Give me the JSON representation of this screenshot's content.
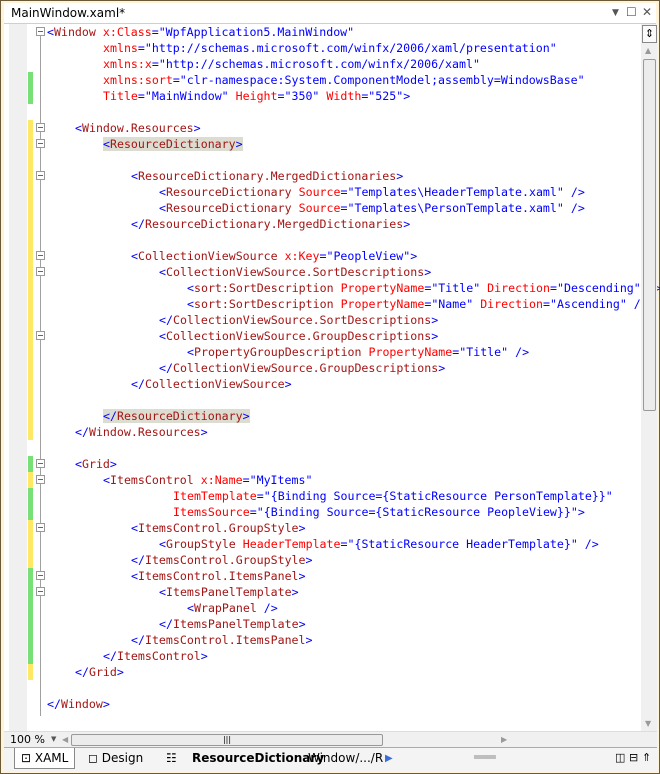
{
  "window": {
    "title": "MainWindow.xaml*"
  },
  "status": {
    "zoom": "100 %"
  },
  "bottom_tabs": [
    {
      "label": "XAML",
      "active": true
    },
    {
      "label": "Design",
      "active": false
    }
  ],
  "breadcrumb": {
    "current": "ResourceDictionary",
    "path": "Window/.../R"
  },
  "colors": {
    "tag": "#a31515",
    "attr": "#ff0000",
    "punct": "#0000ff",
    "changed_saved": "#77e177",
    "changed_unsaved": "#ffe866"
  },
  "code_lines": [
    {
      "indent": 0,
      "fold": true,
      "tokens": [
        [
          "p",
          "<"
        ],
        [
          "n",
          "Window"
        ],
        [
          "a",
          " x:Class"
        ],
        [
          "p",
          "="
        ],
        [
          "v",
          "\"WpfApplication5.MainWindow\""
        ]
      ]
    },
    {
      "indent": 8,
      "tokens": [
        [
          "a",
          "xmlns"
        ],
        [
          "p",
          "="
        ],
        [
          "v",
          "\"http://schemas.microsoft.com/winfx/2006/xaml/presentation\""
        ]
      ]
    },
    {
      "indent": 8,
      "tokens": [
        [
          "a",
          "xmlns:x"
        ],
        [
          "p",
          "="
        ],
        [
          "v",
          "\"http://schemas.microsoft.com/winfx/2006/xaml\""
        ]
      ]
    },
    {
      "indent": 8,
      "change": "green",
      "tokens": [
        [
          "a",
          "xmlns:sort"
        ],
        [
          "p",
          "="
        ],
        [
          "v",
          "\"clr-namespace:System.ComponentModel;assembly=WindowsBase\""
        ]
      ]
    },
    {
      "indent": 8,
      "change": "green",
      "tokens": [
        [
          "a",
          "Title"
        ],
        [
          "p",
          "="
        ],
        [
          "v",
          "\"MainWindow\""
        ],
        [
          "a",
          " Height"
        ],
        [
          "p",
          "="
        ],
        [
          "v",
          "\"350\""
        ],
        [
          "a",
          " Width"
        ],
        [
          "p",
          "="
        ],
        [
          "v",
          "\"525\""
        ],
        [
          "p",
          ">"
        ]
      ]
    },
    {
      "indent": 0,
      "tokens": []
    },
    {
      "indent": 4,
      "fold": true,
      "change": "yellow",
      "tokens": [
        [
          "p",
          "<"
        ],
        [
          "n",
          "Window.Resources"
        ],
        [
          "p",
          ">"
        ]
      ]
    },
    {
      "indent": 8,
      "fold": true,
      "change": "yellow",
      "highlight": true,
      "tokens": [
        [
          "p",
          "<"
        ],
        [
          "n",
          "ResourceDictionary"
        ],
        [
          "p",
          ">"
        ]
      ]
    },
    {
      "indent": 0,
      "change": "yellow",
      "tokens": []
    },
    {
      "indent": 12,
      "fold": true,
      "change": "yellow",
      "tokens": [
        [
          "p",
          "<"
        ],
        [
          "n",
          "ResourceDictionary.MergedDictionaries"
        ],
        [
          "p",
          ">"
        ]
      ]
    },
    {
      "indent": 16,
      "change": "yellow",
      "tokens": [
        [
          "p",
          "<"
        ],
        [
          "n",
          "ResourceDictionary"
        ],
        [
          "a",
          " Source"
        ],
        [
          "p",
          "="
        ],
        [
          "v",
          "\"Templates\\HeaderTemplate.xaml\""
        ],
        [
          "p",
          " />"
        ]
      ]
    },
    {
      "indent": 16,
      "change": "yellow",
      "tokens": [
        [
          "p",
          "<"
        ],
        [
          "n",
          "ResourceDictionary"
        ],
        [
          "a",
          " Source"
        ],
        [
          "p",
          "="
        ],
        [
          "v",
          "\"Templates\\PersonTemplate.xaml\""
        ],
        [
          "p",
          " />"
        ]
      ]
    },
    {
      "indent": 12,
      "change": "yellow",
      "tokens": [
        [
          "p",
          "</"
        ],
        [
          "n",
          "ResourceDictionary.MergedDictionaries"
        ],
        [
          "p",
          ">"
        ]
      ]
    },
    {
      "indent": 0,
      "change": "yellow",
      "tokens": []
    },
    {
      "indent": 12,
      "fold": true,
      "change": "yellow",
      "tokens": [
        [
          "p",
          "<"
        ],
        [
          "n",
          "CollectionViewSource"
        ],
        [
          "a",
          " x:Key"
        ],
        [
          "p",
          "="
        ],
        [
          "v",
          "\"PeopleView\""
        ],
        [
          "p",
          ">"
        ]
      ]
    },
    {
      "indent": 16,
      "fold": true,
      "change": "yellow",
      "tokens": [
        [
          "p",
          "<"
        ],
        [
          "n",
          "CollectionViewSource.SortDescriptions"
        ],
        [
          "p",
          ">"
        ]
      ]
    },
    {
      "indent": 20,
      "change": "yellow",
      "tokens": [
        [
          "p",
          "<"
        ],
        [
          "n",
          "sort:SortDescription"
        ],
        [
          "a",
          " PropertyName"
        ],
        [
          "p",
          "="
        ],
        [
          "v",
          "\"Title\""
        ],
        [
          "a",
          " Direction"
        ],
        [
          "p",
          "="
        ],
        [
          "v",
          "\"Descending\""
        ],
        [
          "p",
          " />"
        ]
      ]
    },
    {
      "indent": 20,
      "change": "yellow",
      "tokens": [
        [
          "p",
          "<"
        ],
        [
          "n",
          "sort:SortDescription"
        ],
        [
          "a",
          " PropertyName"
        ],
        [
          "p",
          "="
        ],
        [
          "v",
          "\"Name\""
        ],
        [
          "a",
          " Direction"
        ],
        [
          "p",
          "="
        ],
        [
          "v",
          "\"Ascending\""
        ],
        [
          "p",
          " />"
        ]
      ]
    },
    {
      "indent": 16,
      "change": "yellow",
      "tokens": [
        [
          "p",
          "</"
        ],
        [
          "n",
          "CollectionViewSource.SortDescriptions"
        ],
        [
          "p",
          ">"
        ]
      ]
    },
    {
      "indent": 16,
      "fold": true,
      "change": "yellow",
      "tokens": [
        [
          "p",
          "<"
        ],
        [
          "n",
          "CollectionViewSource.GroupDescriptions"
        ],
        [
          "p",
          ">"
        ]
      ]
    },
    {
      "indent": 20,
      "change": "yellow",
      "tokens": [
        [
          "p",
          "<"
        ],
        [
          "n",
          "PropertyGroupDescription"
        ],
        [
          "a",
          " PropertyName"
        ],
        [
          "p",
          "="
        ],
        [
          "v",
          "\"Title\""
        ],
        [
          "p",
          " />"
        ]
      ]
    },
    {
      "indent": 16,
      "change": "yellow",
      "tokens": [
        [
          "p",
          "</"
        ],
        [
          "n",
          "CollectionViewSource.GroupDescriptions"
        ],
        [
          "p",
          ">"
        ]
      ]
    },
    {
      "indent": 12,
      "change": "yellow",
      "tokens": [
        [
          "p",
          "</"
        ],
        [
          "n",
          "CollectionViewSource"
        ],
        [
          "p",
          ">"
        ]
      ]
    },
    {
      "indent": 0,
      "change": "yellow",
      "tokens": []
    },
    {
      "indent": 8,
      "change": "yellow",
      "highlight": true,
      "tokens": [
        [
          "p",
          "</"
        ],
        [
          "n",
          "ResourceDictionary"
        ],
        [
          "p",
          ">"
        ]
      ]
    },
    {
      "indent": 4,
      "change": "yellow",
      "tokens": [
        [
          "p",
          "</"
        ],
        [
          "n",
          "Window.Resources"
        ],
        [
          "p",
          ">"
        ]
      ]
    },
    {
      "indent": 0,
      "tokens": []
    },
    {
      "indent": 4,
      "fold": true,
      "change": "green",
      "tokens": [
        [
          "p",
          "<"
        ],
        [
          "n",
          "Grid"
        ],
        [
          "p",
          ">"
        ]
      ]
    },
    {
      "indent": 8,
      "fold": true,
      "change": "yellow",
      "tokens": [
        [
          "p",
          "<"
        ],
        [
          "n",
          "ItemsControl"
        ],
        [
          "a",
          " x:Name"
        ],
        [
          "p",
          "="
        ],
        [
          "v",
          "\"MyItems\""
        ]
      ]
    },
    {
      "indent": 18,
      "change": "green",
      "tokens": [
        [
          "a",
          "ItemTemplate"
        ],
        [
          "p",
          "="
        ],
        [
          "v",
          "\"{Binding Source={StaticResource PersonTemplate}}\""
        ]
      ]
    },
    {
      "indent": 18,
      "change": "green",
      "tokens": [
        [
          "a",
          "ItemsSource"
        ],
        [
          "p",
          "="
        ],
        [
          "v",
          "\"{Binding Source={StaticResource PeopleView}}\""
        ],
        [
          "p",
          ">"
        ]
      ]
    },
    {
      "indent": 12,
      "fold": true,
      "change": "yellow",
      "tokens": [
        [
          "p",
          "<"
        ],
        [
          "n",
          "ItemsControl.GroupStyle"
        ],
        [
          "p",
          ">"
        ]
      ]
    },
    {
      "indent": 16,
      "change": "yellow",
      "tokens": [
        [
          "p",
          "<"
        ],
        [
          "n",
          "GroupStyle"
        ],
        [
          "a",
          " HeaderTemplate"
        ],
        [
          "p",
          "="
        ],
        [
          "v",
          "\"{StaticResource HeaderTemplate}\""
        ],
        [
          "p",
          " />"
        ]
      ]
    },
    {
      "indent": 12,
      "change": "yellow",
      "tokens": [
        [
          "p",
          "</"
        ],
        [
          "n",
          "ItemsControl.GroupStyle"
        ],
        [
          "p",
          ">"
        ]
      ]
    },
    {
      "indent": 12,
      "fold": true,
      "change": "green",
      "tokens": [
        [
          "p",
          "<"
        ],
        [
          "n",
          "ItemsControl.ItemsPanel"
        ],
        [
          "p",
          ">"
        ]
      ]
    },
    {
      "indent": 16,
      "fold": true,
      "change": "green",
      "tokens": [
        [
          "p",
          "<"
        ],
        [
          "n",
          "ItemsPanelTemplate"
        ],
        [
          "p",
          ">"
        ]
      ]
    },
    {
      "indent": 20,
      "change": "green",
      "tokens": [
        [
          "p",
          "<"
        ],
        [
          "n",
          "WrapPanel"
        ],
        [
          "p",
          " />"
        ]
      ]
    },
    {
      "indent": 16,
      "change": "green",
      "tokens": [
        [
          "p",
          "</"
        ],
        [
          "n",
          "ItemsPanelTemplate"
        ],
        [
          "p",
          ">"
        ]
      ]
    },
    {
      "indent": 12,
      "change": "green",
      "tokens": [
        [
          "p",
          "</"
        ],
        [
          "n",
          "ItemsControl.ItemsPanel"
        ],
        [
          "p",
          ">"
        ]
      ]
    },
    {
      "indent": 8,
      "change": "green",
      "tokens": [
        [
          "p",
          "</"
        ],
        [
          "n",
          "ItemsControl"
        ],
        [
          "p",
          ">"
        ]
      ]
    },
    {
      "indent": 4,
      "change": "yellow",
      "tokens": [
        [
          "p",
          "</"
        ],
        [
          "n",
          "Grid"
        ],
        [
          "p",
          ">"
        ]
      ]
    },
    {
      "indent": 0,
      "tokens": []
    },
    {
      "indent": 0,
      "tokens": [
        [
          "p",
          "</"
        ],
        [
          "n",
          "Window"
        ],
        [
          "p",
          ">"
        ]
      ]
    }
  ]
}
